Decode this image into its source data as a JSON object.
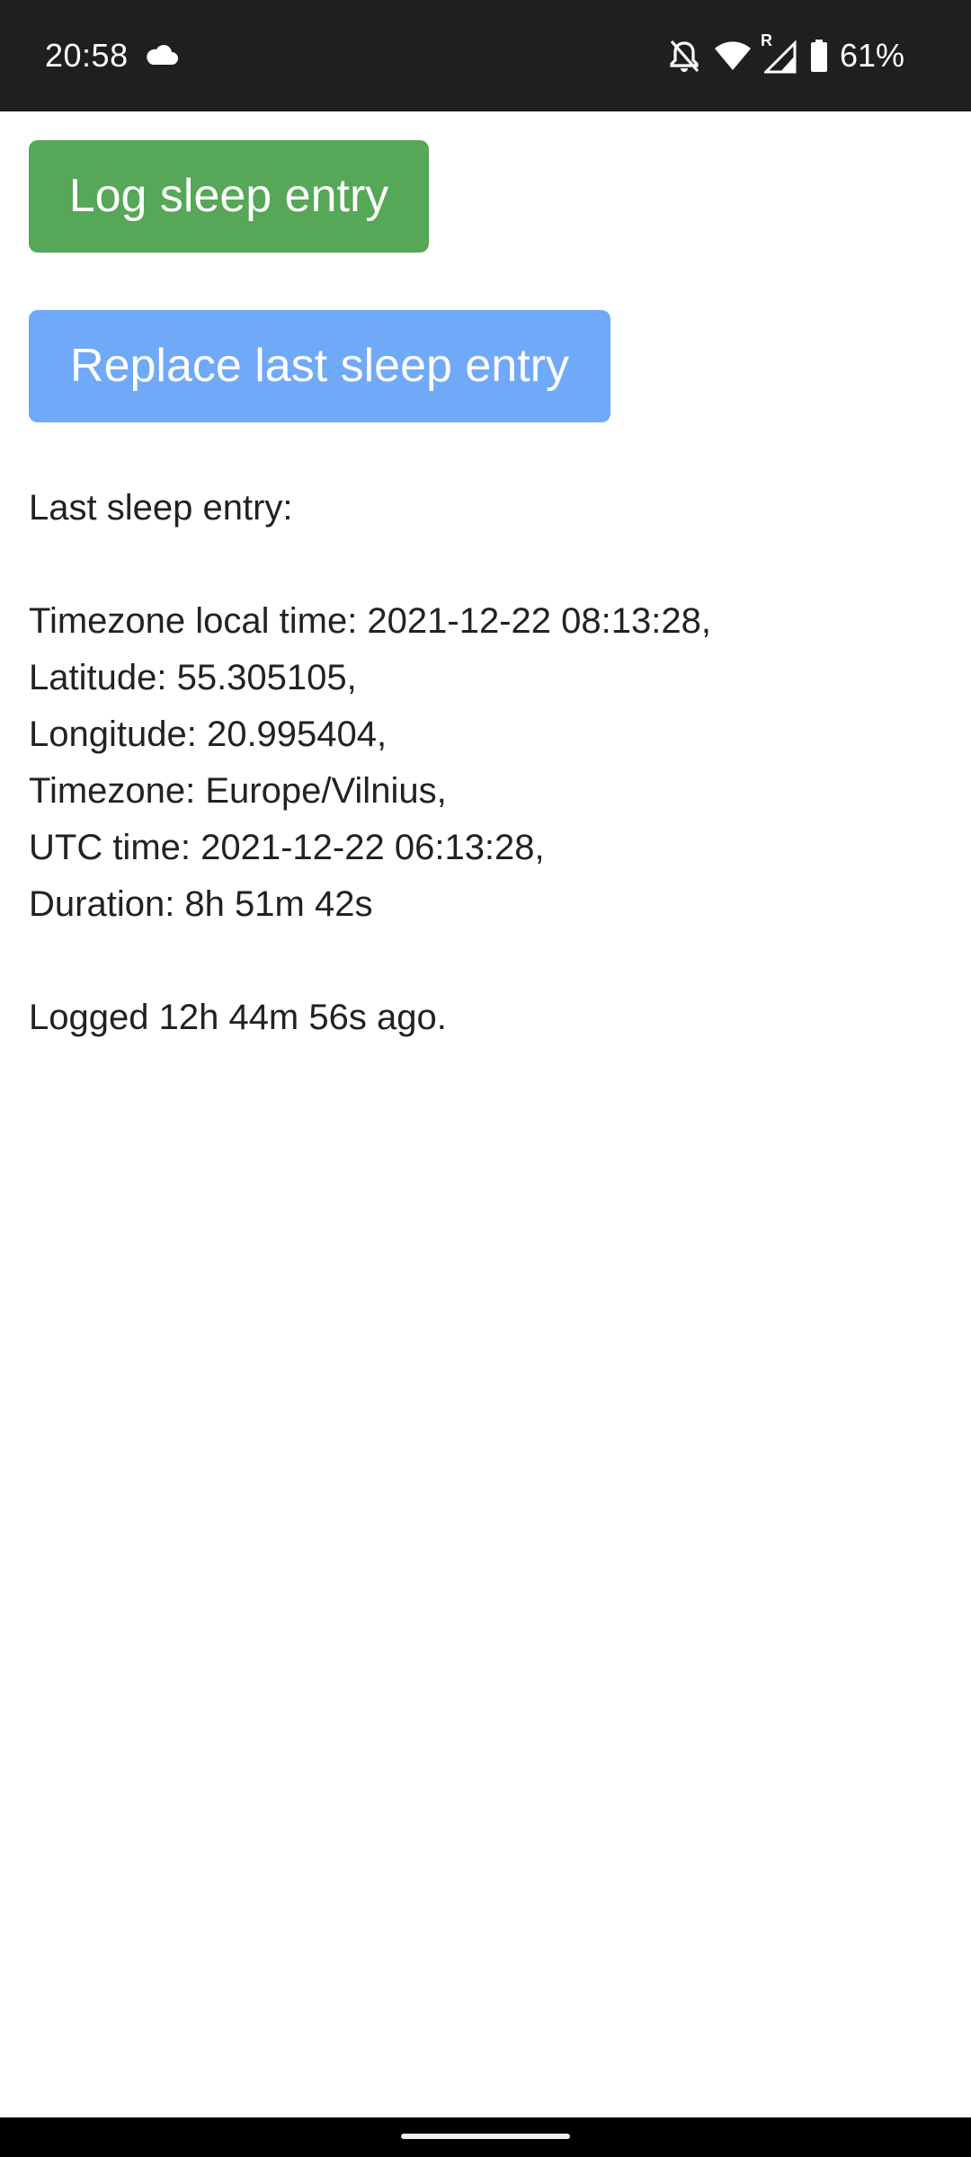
{
  "status_bar": {
    "time": "20:58",
    "battery": "61%",
    "network_label": "R",
    "icons": [
      "cloud-icon",
      "bell-off-icon",
      "wifi-icon",
      "signal-icon",
      "battery-icon"
    ]
  },
  "buttons": {
    "log_label": "Log sleep entry",
    "replace_label": "Replace last sleep entry",
    "log_color": "#56a757",
    "replace_color": "#70a9f8"
  },
  "last_entry": {
    "heading": "Last sleep entry:",
    "local_time": "Timezone local time: 2021-12-22 08:13:28,",
    "latitude": "Latitude: 55.305105,",
    "longitude": "Longitude: 20.995404,",
    "timezone": "Timezone: Europe/Vilnius,",
    "utc_time": "UTC time: 2021-12-22 06:13:28,",
    "duration": "Duration: 8h 51m 42s",
    "logged_ago": "Logged 12h 44m 56s ago."
  }
}
